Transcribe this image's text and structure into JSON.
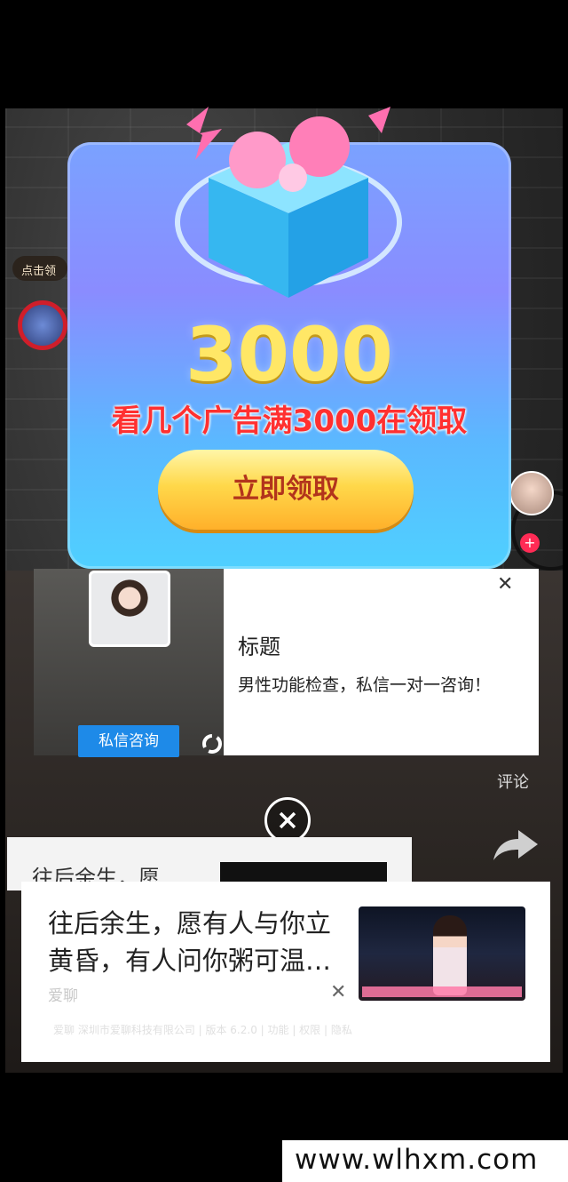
{
  "video": {
    "tap_label": "点击领",
    "side_comment_label": "评论"
  },
  "promo": {
    "amount": "3000",
    "subtitle": "看几个广告满3000在领取",
    "claim_button": "立即领取"
  },
  "top_ad": {
    "consult_button": "私信咨询",
    "title": "标题",
    "description": "男性功能检查，私信一对一咨询！"
  },
  "background_card": {
    "text": "往后余生，愿"
  },
  "bottom_ad": {
    "headline": "往后余生，愿有人与你立黄昏，有人问你粥可温…",
    "source": "爱聊",
    "meta": "爱聊 深圳市爱聊科技有限公司 | 版本 6.2.0 | 功能 | 权限 | 隐私"
  },
  "watermark": {
    "url": "www.wlhxm.com"
  },
  "icons": [
    "close-icon",
    "share-icon",
    "refresh-icon",
    "plus-icon"
  ]
}
